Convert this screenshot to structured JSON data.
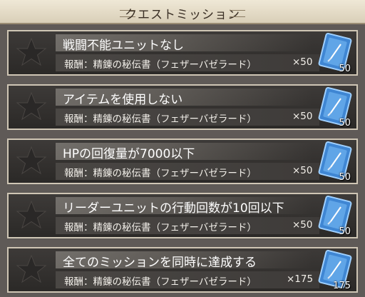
{
  "header": {
    "title": "クエストミッション"
  },
  "missions": [
    {
      "name": "戦闘不能ユニットなし",
      "reward": "報酬：精錬の秘伝書（フェザーバゼラード）",
      "quantity": "×50",
      "count": "50"
    },
    {
      "name": "アイテムを使用しない",
      "reward": "報酬：精錬の秘伝書（フェザーバゼラード）",
      "quantity": "×50",
      "count": "50"
    },
    {
      "name": "HPの回復量が7000以下",
      "reward": "報酬：精錬の秘伝書（フェザーバゼラード）",
      "quantity": "×50",
      "count": "50"
    },
    {
      "name": "リーダーユニットの行動回数が10回以下",
      "reward": "報酬：精錬の秘伝書（フェザーバゼラード）",
      "quantity": "×50",
      "count": "50"
    },
    {
      "name": "全てのミッションを同時に達成する",
      "reward": "報酬：精錬の秘伝書（フェザーバゼラード）",
      "quantity": "×175",
      "count": "175"
    }
  ],
  "icons": {
    "star": "star-icon",
    "reward_item": "secret-book-icon"
  },
  "colors": {
    "header_bg": "#e6dfcc",
    "panel_bg": "#34312f",
    "panel_border": "#cfc6b5",
    "book_blue": "#4a8fd6"
  }
}
